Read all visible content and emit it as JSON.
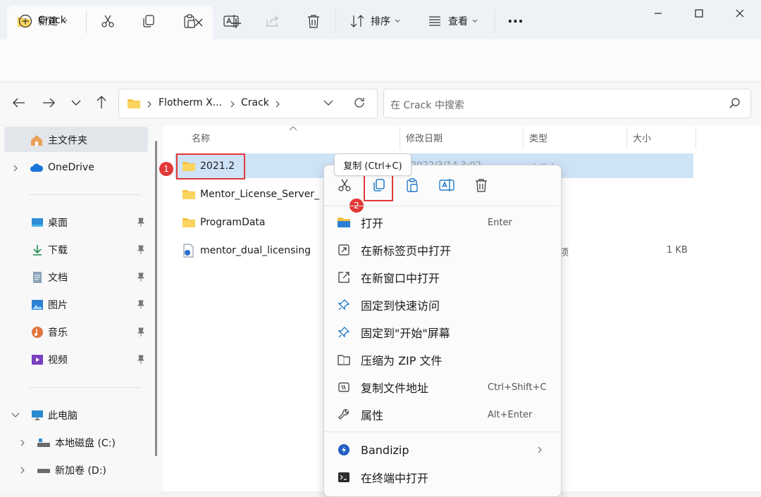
{
  "window": {
    "tab_title": "Crack"
  },
  "toolbar": {
    "new_label": "新建",
    "sort_label": "排序",
    "view_label": "查看",
    "more_label": "···"
  },
  "address": {
    "crumbs": [
      "Flotherm X...",
      "Crack"
    ],
    "search_placeholder": "在 Crack 中搜索"
  },
  "sidebar": {
    "home": "主文件夹",
    "onedrive": "OneDrive",
    "quick": [
      "桌面",
      "下载",
      "文档",
      "图片",
      "音乐",
      "视频"
    ],
    "thispc": "此电脑",
    "drives": [
      "本地磁盘 (C:)",
      "新加卷 (D:)"
    ]
  },
  "columns": {
    "name": "名称",
    "modified": "修改日期",
    "type": "类型",
    "size": "大小"
  },
  "files": [
    {
      "name": "2021.2",
      "date": "2022/3/14 3:02",
      "type": "文件夹",
      "size": ""
    },
    {
      "name": "Mentor_License_Server_",
      "date": "",
      "type": "",
      "size": ""
    },
    {
      "name": "ProgramData",
      "date": "",
      "type": "",
      "size": ""
    },
    {
      "name": "mentor_dual_licensing",
      "date": "",
      "type": "项",
      "size": "1 KB"
    }
  ],
  "tooltip": "复制 (Ctrl+C)",
  "badges": [
    "1",
    "2"
  ],
  "menu": {
    "items": [
      {
        "label": "打开",
        "shortcut": "Enter"
      },
      {
        "label": "在新标签页中打开",
        "shortcut": ""
      },
      {
        "label": "在新窗口中打开",
        "shortcut": ""
      },
      {
        "label": "固定到快速访问",
        "shortcut": ""
      },
      {
        "label": "固定到\"开始\"屏幕",
        "shortcut": ""
      },
      {
        "label": "压缩为 ZIP 文件",
        "shortcut": ""
      },
      {
        "label": "复制文件地址",
        "shortcut": "Ctrl+Shift+C"
      },
      {
        "label": "属性",
        "shortcut": "Alt+Enter"
      },
      {
        "label": "Bandizip",
        "shortcut": ""
      },
      {
        "label": "在终端中打开",
        "shortcut": ""
      }
    ]
  },
  "colors": {
    "accent": "#0067c0",
    "highlight": "#e23838",
    "folder": "#f5c242"
  }
}
